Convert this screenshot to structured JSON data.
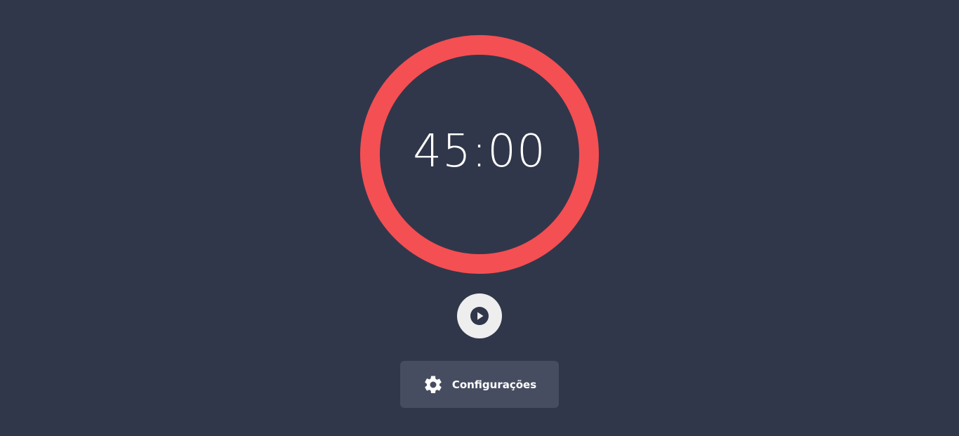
{
  "timer": {
    "display": "45:00",
    "ring_color": "#f44f53"
  },
  "controls": {
    "play_icon": "play-icon",
    "play_button_color": "#eeeeee"
  },
  "settings": {
    "icon": "gear-icon",
    "label": "Configurações",
    "button_color": "#474d60"
  },
  "theme": {
    "background": "#31374a",
    "text_color": "#ffffff"
  }
}
